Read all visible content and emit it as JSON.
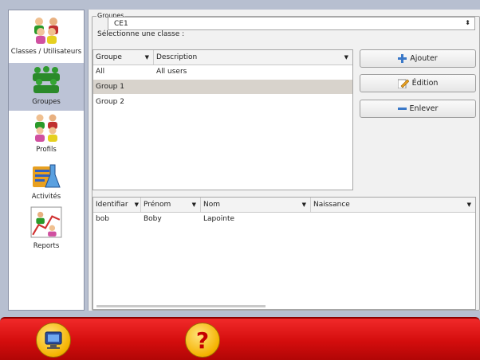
{
  "nav": {
    "items": [
      {
        "label": "Classes / Utilisateurs",
        "icon": "users-group-icon"
      },
      {
        "label": "Groupes",
        "icon": "group-icon"
      },
      {
        "label": "Profils",
        "icon": "profiles-icon"
      },
      {
        "label": "Activités",
        "icon": "activities-icon"
      },
      {
        "label": "Reports",
        "icon": "reports-icon"
      }
    ]
  },
  "groups_frame": {
    "legend": "Groupes",
    "class_label": "Sélectionne une classe :",
    "class_value": "CE1"
  },
  "groups_table": {
    "headers": {
      "group": "Groupe",
      "description": "Description"
    },
    "rows": [
      {
        "group": "All",
        "description": "All users"
      },
      {
        "group": "Group 1",
        "description": ""
      },
      {
        "group": "Group 2",
        "description": ""
      }
    ]
  },
  "buttons": {
    "add": "Ajouter",
    "edit": "Édition",
    "remove": "Enlever"
  },
  "members_table": {
    "headers": {
      "id": "Identifiar",
      "firstname": "Prénom",
      "lastname": "Nom",
      "birth": "Naissance"
    },
    "rows": [
      {
        "id": "bob",
        "firstname": "Boby",
        "lastname": "Lapointe",
        "birth": ""
      }
    ]
  },
  "bottom_bar": {
    "help_label": "?"
  },
  "colors": {
    "bottom_bar": "#d40d0d",
    "selected_row": "#d8d3cc",
    "nav_active": "#bcc3d6",
    "button_icon_blue": "#3a78c8"
  }
}
